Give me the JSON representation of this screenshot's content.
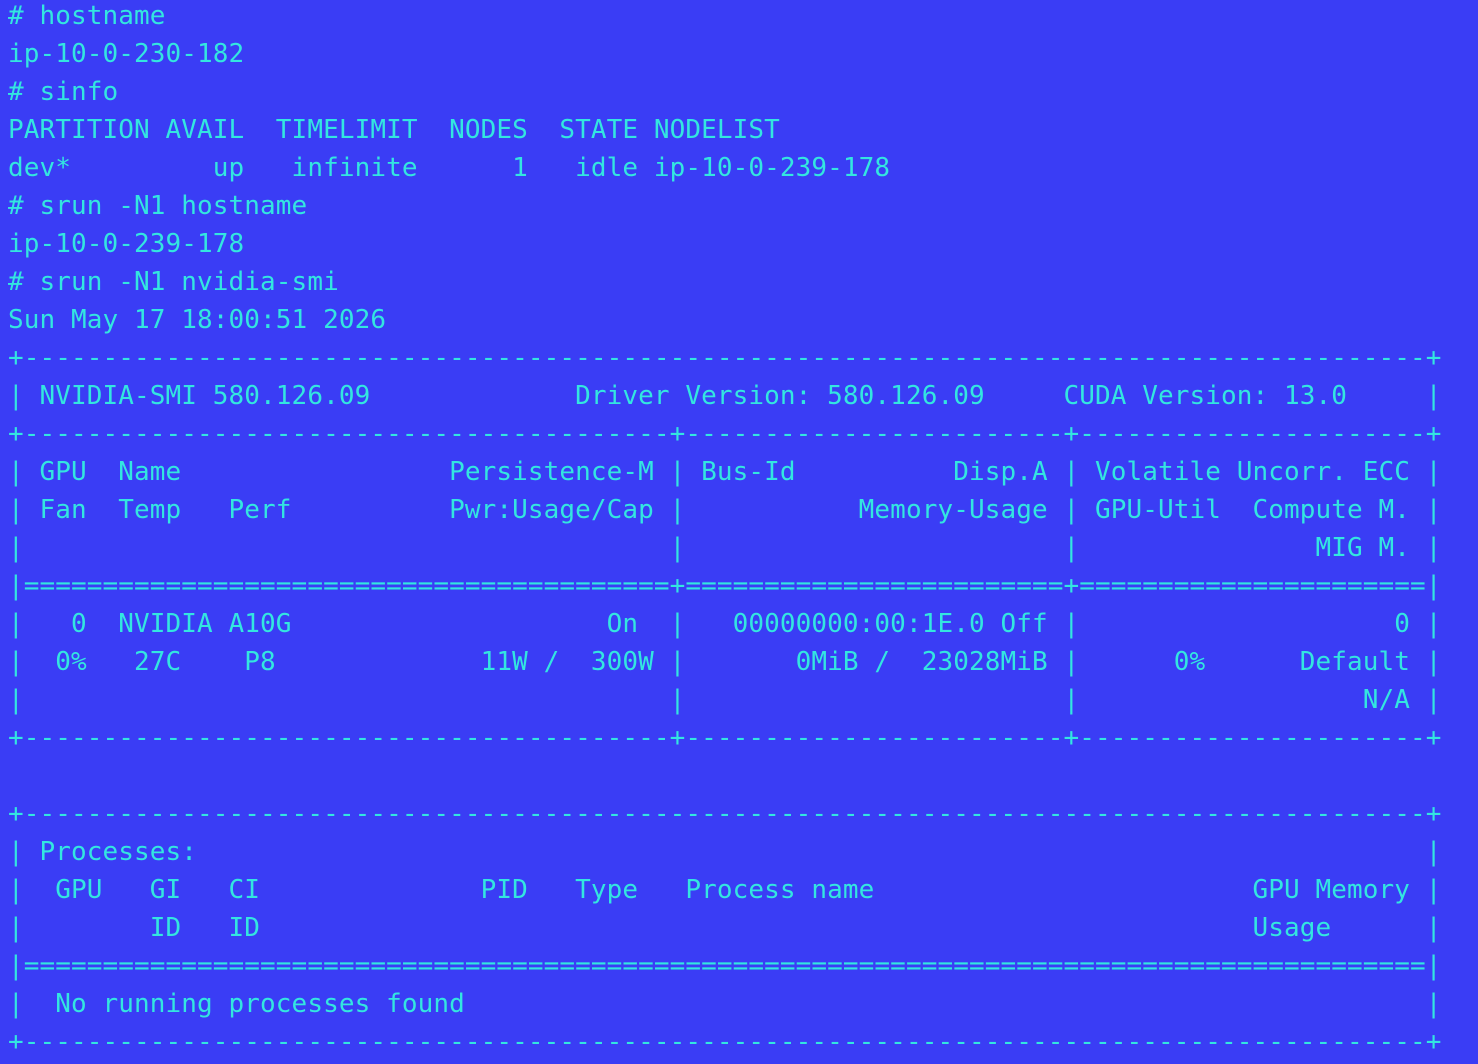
{
  "theme": {
    "background": "#3a3df5",
    "foreground": "#33e6e0"
  },
  "lines": [
    "# hostname",
    "ip-10-0-230-182",
    "# sinfo",
    "PARTITION AVAIL  TIMELIMIT  NODES  STATE NODELIST",
    "dev*         up   infinite      1   idle ip-10-0-239-178",
    "# srun -N1 hostname",
    "ip-10-0-239-178",
    "# srun -N1 nvidia-smi",
    "Sun May 17 18:00:51 2026",
    "+-----------------------------------------------------------------------------------------+",
    "| NVIDIA-SMI 580.126.09             Driver Version: 580.126.09     CUDA Version: 13.0     |",
    "+-----------------------------------------+------------------------+----------------------+",
    "| GPU  Name                 Persistence-M | Bus-Id          Disp.A | Volatile Uncorr. ECC |",
    "| Fan  Temp   Perf          Pwr:Usage/Cap |           Memory-Usage | GPU-Util  Compute M. |",
    "|                                         |                        |               MIG M. |",
    "|=========================================+========================+======================|",
    "|   0  NVIDIA A10G                    On  |   00000000:00:1E.0 Off |                    0 |",
    "|  0%   27C    P8             11W /  300W |       0MiB /  23028MiB |      0%      Default |",
    "|                                         |                        |                  N/A |",
    "+-----------------------------------------+------------------------+----------------------+",
    "",
    "+-----------------------------------------------------------------------------------------+",
    "| Processes:                                                                              |",
    "|  GPU   GI   CI              PID   Type   Process name                        GPU Memory |",
    "|        ID   ID                                                               Usage      |",
    "|=========================================================================================|",
    "|  No running processes found                                                             |",
    "+-----------------------------------------------------------------------------------------+"
  ]
}
